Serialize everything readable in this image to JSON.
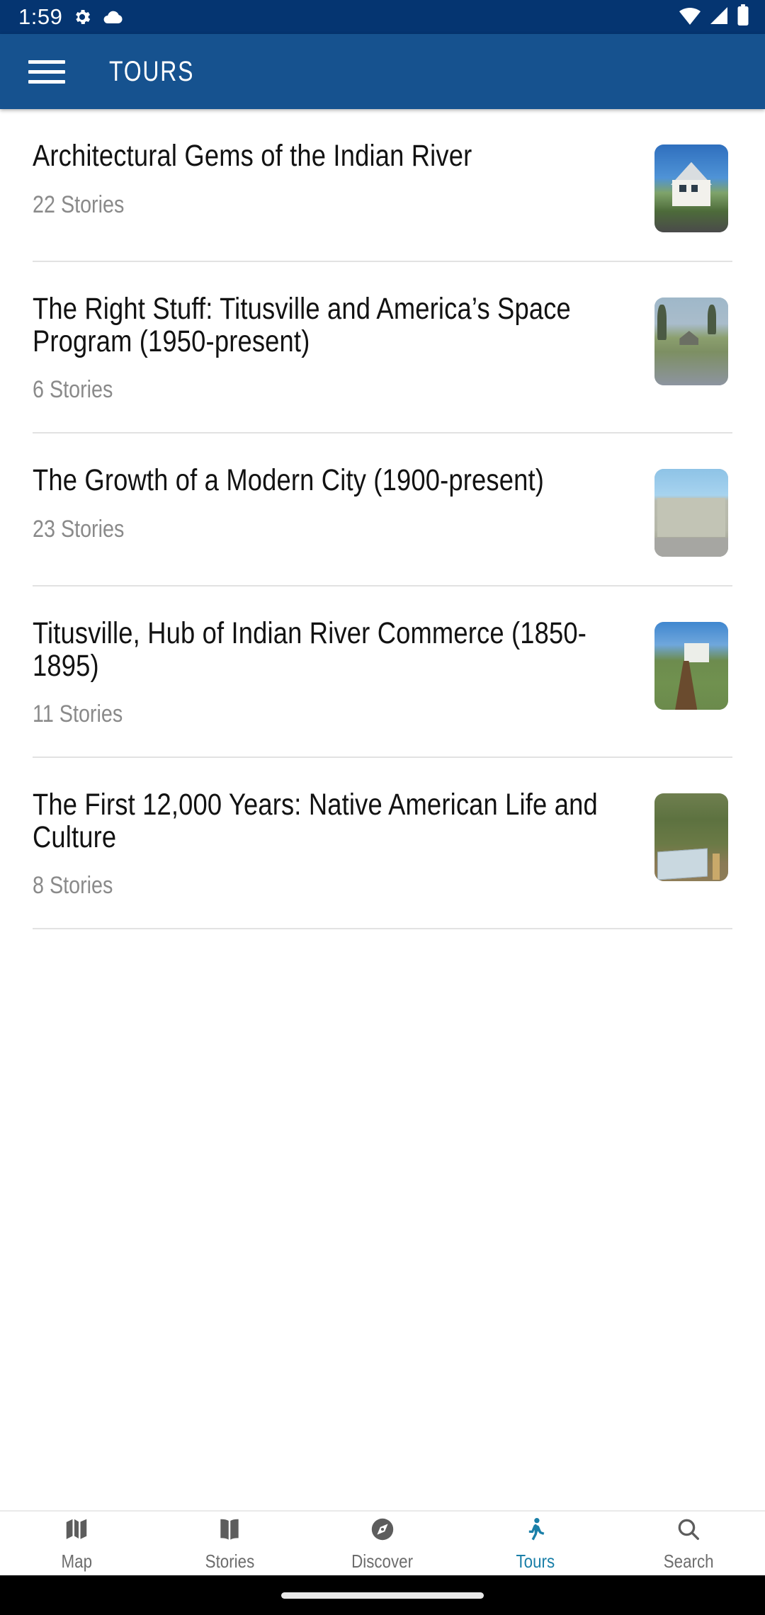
{
  "status_bar": {
    "time": "1:59",
    "left_icons": [
      "gear-icon",
      "cloud-icon"
    ],
    "right_icons": [
      "wifi-icon",
      "cellular-signal-icon",
      "battery-icon"
    ],
    "background_color": "#053571"
  },
  "app_bar": {
    "menu_icon": "hamburger-menu-icon",
    "title": "TOURS",
    "background_color": "#16528f"
  },
  "tours": [
    {
      "title": "Architectural Gems of the Indian River",
      "stories": "22 Stories",
      "thumb": "victorian-house-photo"
    },
    {
      "title": "The Right Stuff: Titusville and America’s Space Program (1950-present)",
      "stories": "6 Stories",
      "thumb": "waterfront-gazebo-photo"
    },
    {
      "title": "The Growth of a Modern City (1900-present)",
      "stories": "23 Stories",
      "thumb": "civic-building-photo"
    },
    {
      "title": "Titusville, Hub of Indian River Commerce (1850-1895)",
      "stories": "11 Stories",
      "thumb": "historic-home-path-photo"
    },
    {
      "title": "The First 12,000 Years: Native American Life and Culture",
      "stories": "8 Stories",
      "thumb": "interpretive-sign-trail-photo"
    }
  ],
  "bottom_nav": {
    "active_color": "#1a7fa8",
    "inactive_color": "#6d6d6d",
    "items": [
      {
        "label": "Map",
        "icon": "map-icon",
        "active": false
      },
      {
        "label": "Stories",
        "icon": "book-icon",
        "active": false
      },
      {
        "label": "Discover",
        "icon": "compass-icon",
        "active": false
      },
      {
        "label": "Tours",
        "icon": "walking-person-icon",
        "active": true
      },
      {
        "label": "Search",
        "icon": "search-icon",
        "active": false
      }
    ]
  }
}
